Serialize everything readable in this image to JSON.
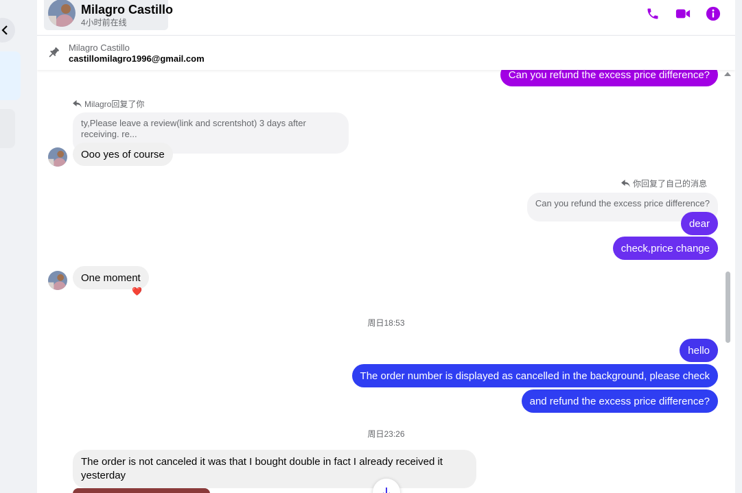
{
  "header": {
    "contact_name": "Milagro Castillo",
    "status": "4小时前在线",
    "icons": [
      "phone-icon",
      "video-icon",
      "info-icon"
    ],
    "accent_color": "#a200e4"
  },
  "pinned": {
    "name": "Milagro Castillo",
    "email": "castillomilagro1996@gmail.com",
    "icon": "pin-icon"
  },
  "messages": {
    "m1": "Can you refund the excess price difference?",
    "reply1_label": "Milagro回复了你",
    "quote1": "ty,Please leave a review(link and screntshot) 3 days after receiving. re...",
    "m2": "Ooo yes of course",
    "reply2_label": "你回复了自己的消息",
    "quote2": "Can you refund the excess price difference?",
    "m3": "dear",
    "m4": "check,price change",
    "m5": "One moment",
    "m5_reaction": "❤️",
    "ts1": "周日18:53",
    "m6": "hello",
    "m7": "The order number is displayed as cancelled in the background, please check",
    "m8": "and  refund the excess price difference?",
    "ts2": "周日23:26",
    "m9": "The order is not canceled it was that I bought double in fact I already received it yesterday"
  },
  "colors": {
    "outgoing_purple": "#a200e4",
    "outgoing_violet": "#6a2ff0",
    "outgoing_blue": "#2f3ef2",
    "incoming_bg": "#f0f0f0"
  }
}
